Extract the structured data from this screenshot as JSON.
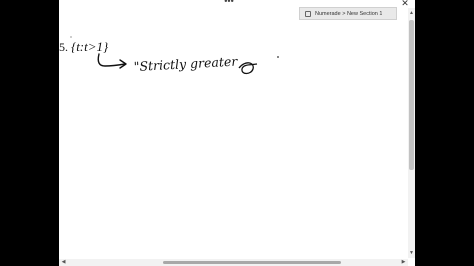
{
  "window": {
    "breadcrumb": "Numerade > New Section 1",
    "more_icon": "more-icon",
    "close_icon": "close-icon"
  },
  "note": {
    "problem_number": "5.",
    "set_expression": "{t:t>1}",
    "handwriting": "\"Strictly greater"
  }
}
